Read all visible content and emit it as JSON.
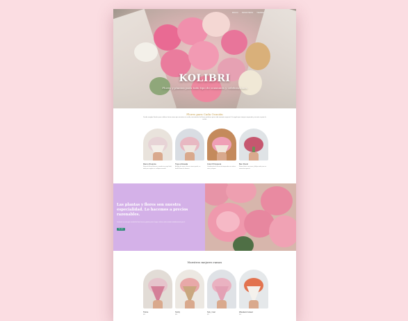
{
  "hero": {
    "nav": [
      "INICIO",
      "NOSOTROS",
      "TIENDA"
    ],
    "brand": "KOLIBRI",
    "tagline": "Flores y plantas para todo tipo de ocasiones y celebraciones"
  },
  "section_occasions": {
    "title": "Flores para Cada Ocasión",
    "text": "Desde arreglos florales para celebrar hasta ramos que muestran tu cariño, encontrarás las flores perfectas para cada momento especial. Un regalo que siempre sorprende y encanta a quien lo recibe.",
    "cards": [
      {
        "name": "Ramo Dreamie",
        "desc": "Ramo de flores blancas y rosadas en papel kraft, ideal para regalar en cualquier ocasión.",
        "price": ""
      },
      {
        "name": "Tiga a Rosada",
        "desc": "Arreglo de rosas y lirios en tonos pastel, un detalle lleno de romance.",
        "price": ""
      },
      {
        "name": "Color Primavera",
        "desc": "Combinación de flores de temporada con colores vivos y alegres.",
        "price": ""
      },
      {
        "name": "Ben Floral",
        "desc": "Ramo clásico con rosas y follaje verde para un momento especial.",
        "price": ""
      }
    ]
  },
  "promo": {
    "headline": "Las plantas y flores son nuestra especialidad. Lo hacemos a precios razonables.",
    "body": "Contamos con una gran variedad de flores frescas y plantas para tu hogar u oficina, seleccionadas cuidadosamente para ti.",
    "button": "Ver más"
  },
  "section_best": {
    "title": "Nuestros mejores ramos",
    "cards": [
      {
        "name": "Twine",
        "price": "$45"
      },
      {
        "name": "Smily",
        "price": "$38"
      },
      {
        "name": "Sol y mar",
        "price": "$52"
      },
      {
        "name": "Weekend sweet",
        "price": "$40"
      }
    ]
  },
  "colors": {
    "background": "#fbdde2",
    "accent_gold": "#c59a43",
    "promo_lilac": "#d4b1e8",
    "button_teal": "#2f8a78"
  }
}
